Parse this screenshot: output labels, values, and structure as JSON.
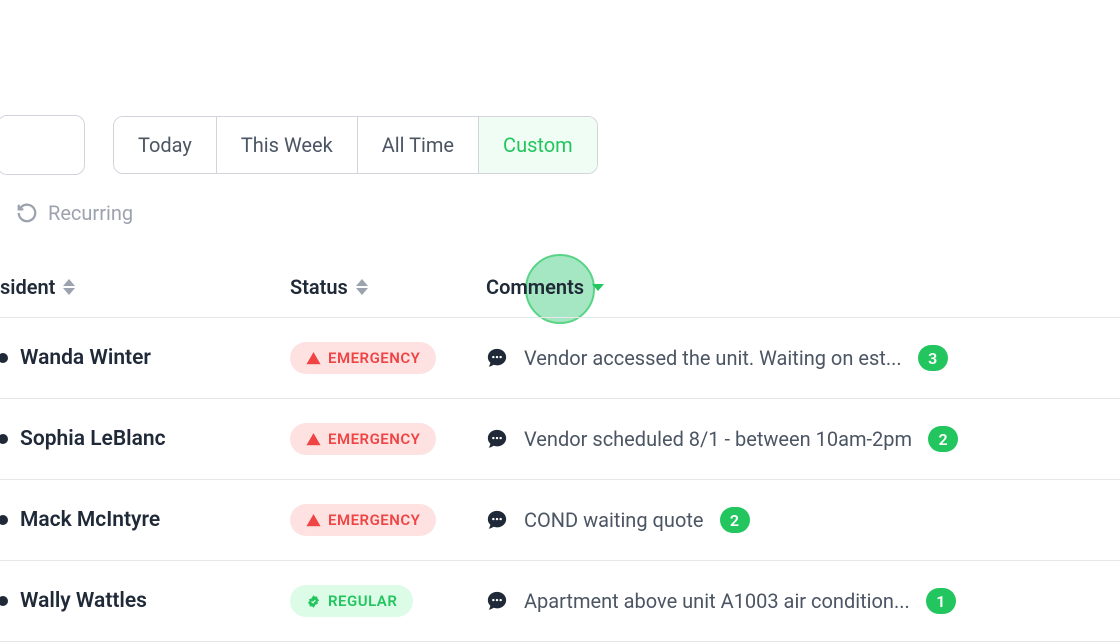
{
  "filters": {
    "tabs": [
      {
        "label": "Today",
        "active": false
      },
      {
        "label": "This Week",
        "active": false
      },
      {
        "label": "All Time",
        "active": false
      },
      {
        "label": "Custom",
        "active": true
      }
    ]
  },
  "recurring": {
    "label": "Recurring"
  },
  "columns": {
    "resident": "sident",
    "status": "Status",
    "comments": "Comments"
  },
  "statuses": {
    "emergency": "EMERGENCY",
    "regular": "REGULAR"
  },
  "rows": [
    {
      "resident": "Wanda Winter",
      "status": "emergency",
      "comment": "Vendor accessed the unit. Waiting on est...",
      "count": "3"
    },
    {
      "resident": "Sophia LeBlanc",
      "status": "emergency",
      "comment": "Vendor scheduled 8/1 - between 10am-2pm",
      "count": "2"
    },
    {
      "resident": "Mack McIntyre",
      "status": "emergency",
      "comment": "COND waiting quote",
      "count": "2"
    },
    {
      "resident": "Wally Wattles",
      "status": "regular",
      "comment": "Apartment above unit A1003 air condition...",
      "count": "1"
    }
  ]
}
